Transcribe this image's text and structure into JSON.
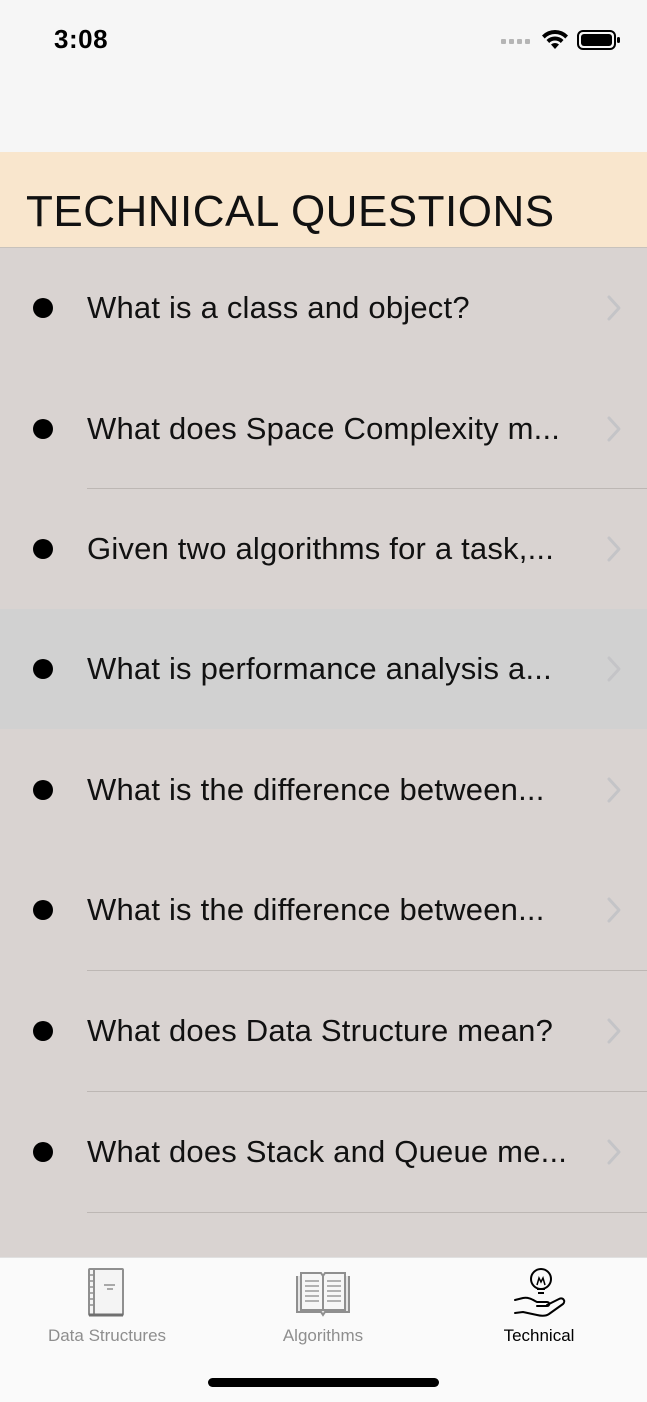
{
  "status_bar": {
    "time": "3:08",
    "icons": [
      "cellular-dots-icon",
      "wifi-icon",
      "battery-icon"
    ]
  },
  "header": {
    "title": "TECHNICAL QUESTIONS",
    "background": "#f9e6cd"
  },
  "list": {
    "background": "#d9d3d1",
    "selected_background": "#d1d1d1",
    "items": [
      {
        "label": "What is a class and object?"
      },
      {
        "label": "What does Space Complexity m..."
      },
      {
        "label": "Given two algorithms for a task,..."
      },
      {
        "label": "What is performance analysis a..."
      },
      {
        "label": "What is the difference between..."
      },
      {
        "label": "What is the difference between..."
      },
      {
        "label": "What does Data Structure mean?"
      },
      {
        "label": "What does Stack and Queue me..."
      }
    ]
  },
  "tab_bar": {
    "tabs": [
      {
        "label": "Data Structures",
        "icon": "notebook-icon",
        "active": false
      },
      {
        "label": "Algorithms",
        "icon": "open-book-icon",
        "active": false
      },
      {
        "label": "Technical",
        "icon": "lightbulb-hand-icon",
        "active": true
      }
    ]
  }
}
